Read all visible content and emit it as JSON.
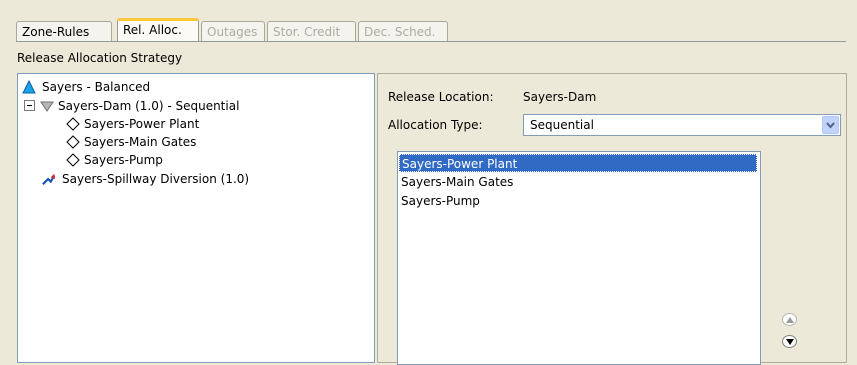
{
  "tabs": [
    {
      "label": "Zone-Rules",
      "state": "normal"
    },
    {
      "label": "Rel. Alloc.",
      "state": "active"
    },
    {
      "label": "Outages",
      "state": "disabled"
    },
    {
      "label": "Stor. Credit",
      "state": "disabled"
    },
    {
      "label": "Dec. Sched.",
      "state": "disabled"
    }
  ],
  "section_label": "Release Allocation Strategy",
  "tree": {
    "root": "Sayers - Balanced",
    "dam": "Sayers-Dam (1.0) - Sequential",
    "children": [
      "Sayers-Power Plant",
      "Sayers-Main Gates",
      "Sayers-Pump"
    ],
    "diversion": "Sayers-Spillway Diversion (1.0)"
  },
  "release_location": {
    "label": "Release Location:",
    "value": "Sayers-Dam"
  },
  "allocation_type": {
    "label": "Allocation Type:",
    "value": "Sequential"
  },
  "allocation_list": [
    "Sayers-Power Plant",
    "Sayers-Main Gates",
    "Sayers-Pump"
  ],
  "colors": {
    "selection": "#316ac5",
    "active_tab_accent": "#ffc73c",
    "panel_bg": "#ece9d8"
  },
  "icons": {
    "root": "triangle-icon",
    "dam": "funnel-icon",
    "gate": "diamond-icon",
    "diversion": "diversion-arrow-icon",
    "collapse": "collapse-icon",
    "move_up": "move-up-icon",
    "move_down": "move-down-icon"
  }
}
